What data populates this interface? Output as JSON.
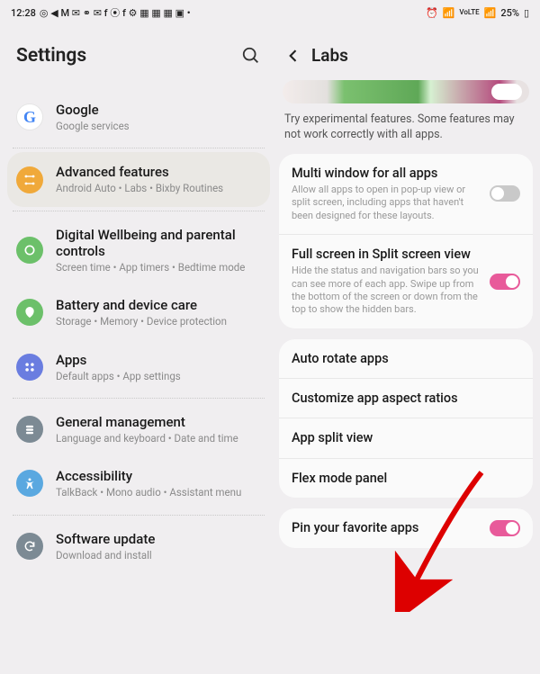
{
  "statusbar": {
    "time": "12:28",
    "battery_text": "25%",
    "net_label": "VoLTE"
  },
  "left": {
    "header": "Settings",
    "items": [
      {
        "key": "google",
        "title": "Google",
        "sub": "Google services",
        "icon_bg": "#ffffff",
        "icon_fg": "#4285F4"
      },
      {
        "key": "advanced",
        "title": "Advanced features",
        "sub": "Android Auto  •  Labs  •  Bixby Routines",
        "icon_bg": "#f0a93a",
        "selected": true
      },
      {
        "key": "wellbeing",
        "title": "Digital Wellbeing and parental controls",
        "sub": "Screen time  •  App timers  •  Bedtime mode",
        "icon_bg": "#6cc06a"
      },
      {
        "key": "battery",
        "title": "Battery and device care",
        "sub": "Storage  •  Memory  •  Device protection",
        "icon_bg": "#6cc06a"
      },
      {
        "key": "apps",
        "title": "Apps",
        "sub": "Default apps  •  App settings",
        "icon_bg": "#6a7de0"
      },
      {
        "key": "general",
        "title": "General management",
        "sub": "Language and keyboard  •  Date and time",
        "icon_bg": "#7c8a94"
      },
      {
        "key": "accessibility",
        "title": "Accessibility",
        "sub": "TalkBack  •  Mono audio  •  Assistant menu",
        "icon_bg": "#5aa8e0"
      },
      {
        "key": "update",
        "title": "Software update",
        "sub": "Download and install",
        "icon_bg": "#7c8a94"
      }
    ]
  },
  "right": {
    "header": "Labs",
    "description": "Try experimental features. Some features may not work correctly with all apps.",
    "card1": [
      {
        "title": "Multi window for all apps",
        "sub": "Allow all apps to open in pop-up view or split screen, including apps that haven't been designed for these layouts.",
        "toggle": "off"
      },
      {
        "title": "Full screen in Split screen view",
        "sub": "Hide the status and navigation bars so you can see more of each app. Swipe up from the bottom of the screen or down from the top to show the hidden bars.",
        "toggle": "on"
      }
    ],
    "card2": [
      {
        "title": "Auto rotate apps"
      },
      {
        "title": "Customize app aspect ratios"
      },
      {
        "title": "App split view"
      },
      {
        "title": "Flex mode panel"
      }
    ],
    "card3": [
      {
        "title": "Pin your favorite apps",
        "toggle": "on"
      }
    ]
  },
  "colors": {
    "accent": "#e85a9a"
  }
}
